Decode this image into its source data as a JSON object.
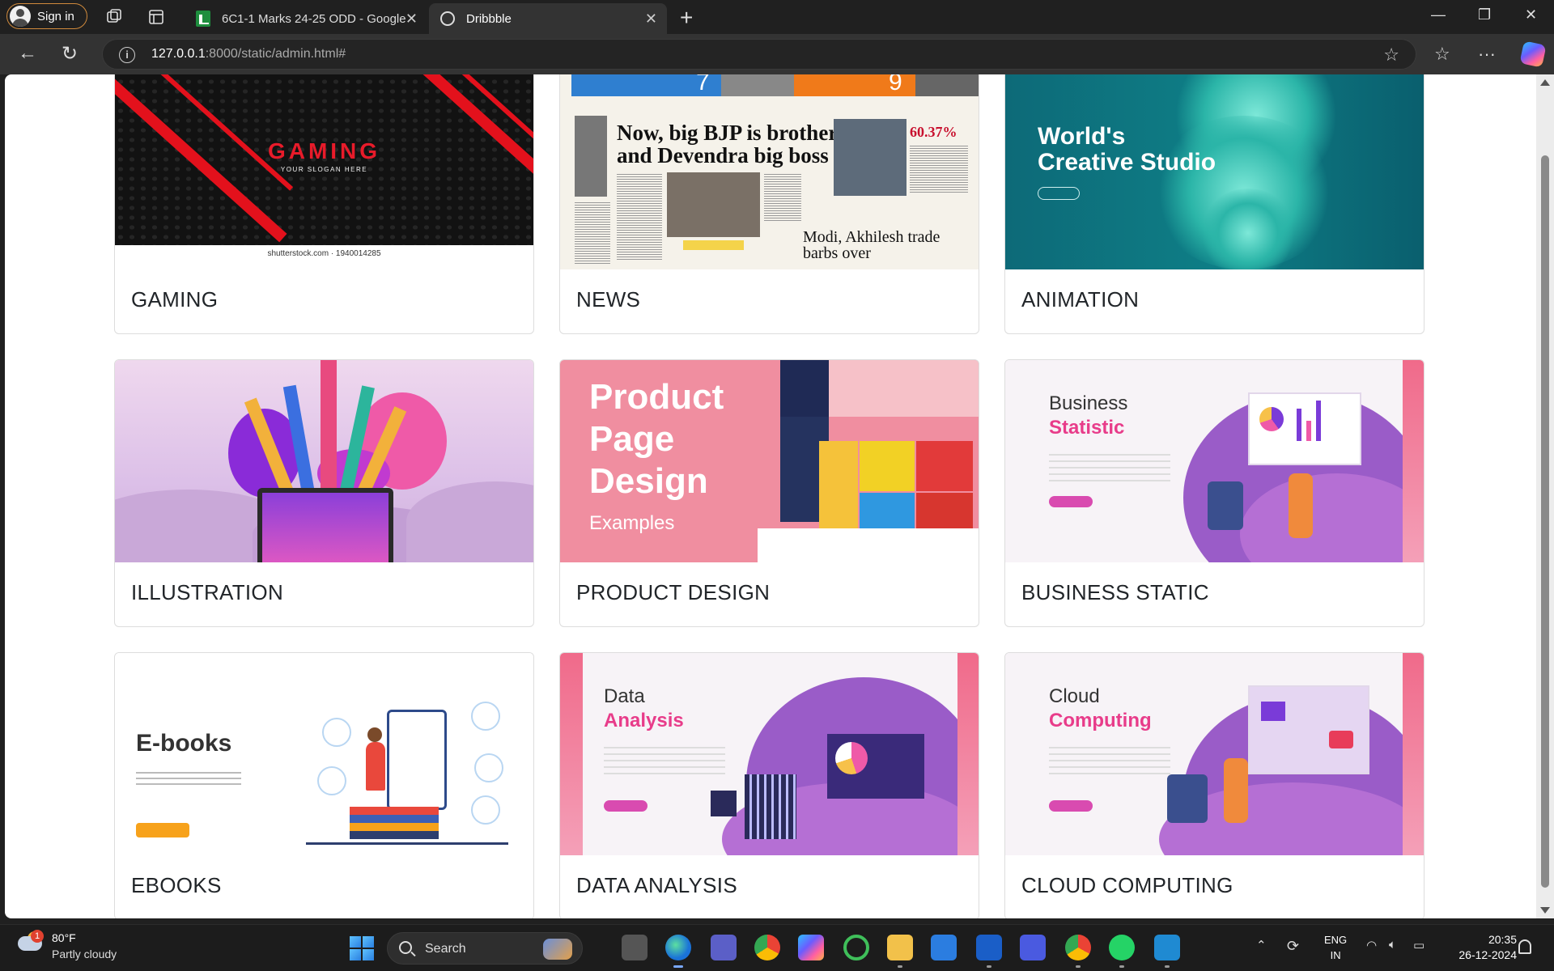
{
  "browser": {
    "signin_label": "Sign in",
    "tabs": [
      {
        "title": "6C1-1 Marks 24-25 ODD - Google",
        "icon": "google-sheets-icon"
      },
      {
        "title": "Dribbble",
        "icon": "globe-icon",
        "active": true
      }
    ],
    "url_host": "127.0.0.1",
    "url_rest": ":8000/static/admin.html#"
  },
  "cards": [
    {
      "title": "GAMING",
      "image": "gaming-banner"
    },
    {
      "title": "NEWS",
      "image": "newspaper-front-page"
    },
    {
      "title": "ANIMATION",
      "image": "creative-studio-banner"
    },
    {
      "title": "ILLUSTRATION",
      "image": "illustration-laptop"
    },
    {
      "title": "PRODUCT DESIGN",
      "image": "product-page-design"
    },
    {
      "title": "BUSINESS STATIC",
      "image": "business-statistic"
    },
    {
      "title": "EBOOKS",
      "image": "ebooks-illustration"
    },
    {
      "title": "DATA ANALYSIS",
      "image": "data-analysis"
    },
    {
      "title": "CLOUD COMPUTING",
      "image": "cloud-computing"
    }
  ],
  "images": {
    "gaming_title": "GAMING",
    "gaming_slogan": "YOUR SLOGAN HERE",
    "gaming_watermark": "shutterstock.com · 1940014285",
    "news_headline_1": "Now, big BJP is brother",
    "news_headline_2": "and Devendra big boss",
    "news_headline_3": "Modi, Akhilesh trade barbs over",
    "news_pct": "60.37%",
    "news_number_7": "7",
    "news_number_9": "9",
    "anim_heading_1": "World's",
    "anim_heading_2": "Creative Studio",
    "prod_line_1": "Product",
    "prod_line_2": "Page",
    "prod_line_3": "Design",
    "prod_examples": "Examples",
    "biz_line_1": "Business",
    "biz_line_2": "Statistic",
    "ebooks_title": "E-books",
    "data_line_1": "Data",
    "data_line_2": "Analysis",
    "cloud_line_1": "Cloud",
    "cloud_line_2": "Computing"
  },
  "taskbar": {
    "weather_badge": "1",
    "temperature": "80°F",
    "condition": "Partly cloudy",
    "search_label": "Search",
    "language_1": "ENG",
    "language_2": "IN",
    "time": "20:35",
    "date": "26-12-2024",
    "apps": [
      "task-view",
      "edge",
      "teams",
      "chrome",
      "copilot",
      "refresh-app",
      "file-explorer",
      "store",
      "lens-app",
      "vector-app",
      "chrome-profile",
      "whatsapp",
      "vscode"
    ]
  },
  "colors": {
    "accent_gaming": "#e3111c",
    "accent_pink": "#e83c8a",
    "card_border": "#dddddd"
  }
}
